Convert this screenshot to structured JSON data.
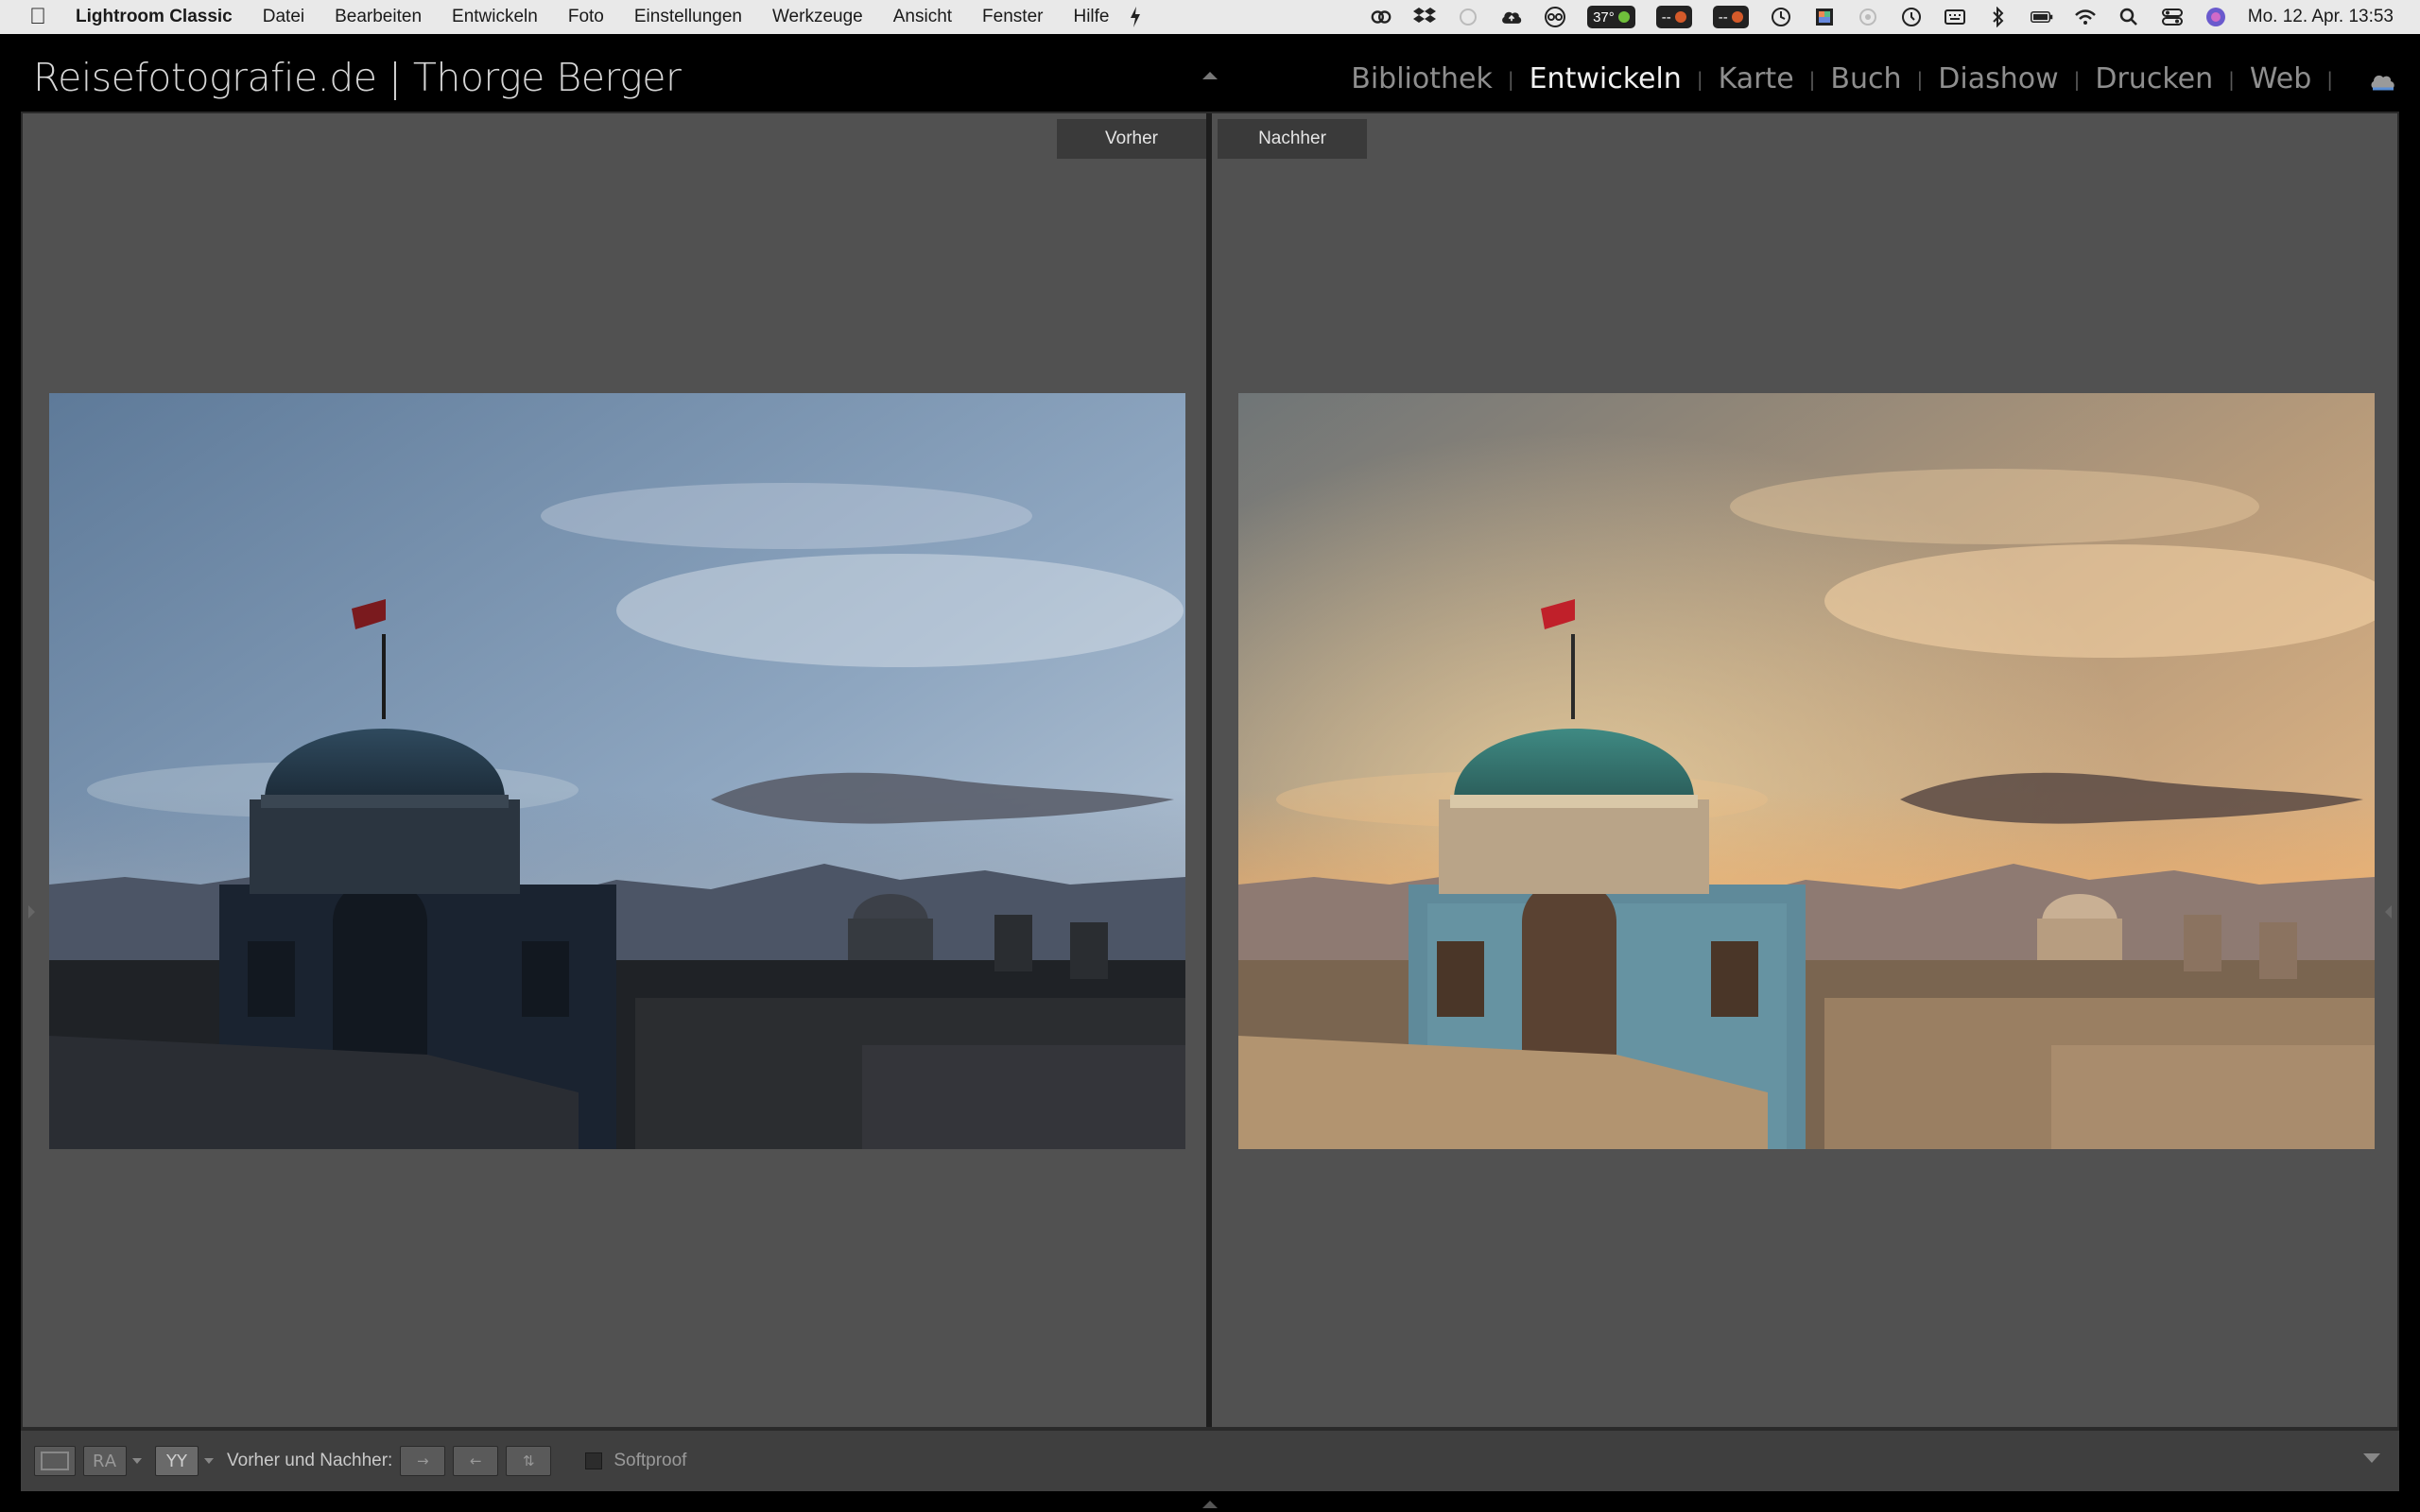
{
  "menubar": {
    "app_name": "Lightroom Classic",
    "menus": [
      "Datei",
      "Bearbeiten",
      "Entwickeln",
      "Foto",
      "Einstellungen",
      "Werkzeuge",
      "Ansicht",
      "Fenster",
      "Hilfe"
    ],
    "temperature": "37°",
    "pill_a": "--",
    "pill_b": "--",
    "clock": "Mo. 12. Apr.  13:53"
  },
  "identity_plate": "Reisefotografie.de | Thorge Berger",
  "modules": {
    "library": "Bibliothek",
    "develop": "Entwickeln",
    "map": "Karte",
    "book": "Buch",
    "slideshow": "Diashow",
    "print": "Drucken",
    "web": "Web",
    "separator": "|"
  },
  "compare": {
    "before_label": "Vorher",
    "after_label": "Nachher"
  },
  "toolbar": {
    "view_ra": "RA",
    "view_yy": "YY",
    "before_after_label": "Vorher und Nachher:",
    "copy_after_to_before": "→",
    "copy_before_to_after": "←",
    "swap": "⇅",
    "softproof_label": "Softproof"
  },
  "colors": {
    "active_module": "#f2f2f2",
    "inactive_module": "#8e8e8e",
    "work_area": "#515151"
  }
}
